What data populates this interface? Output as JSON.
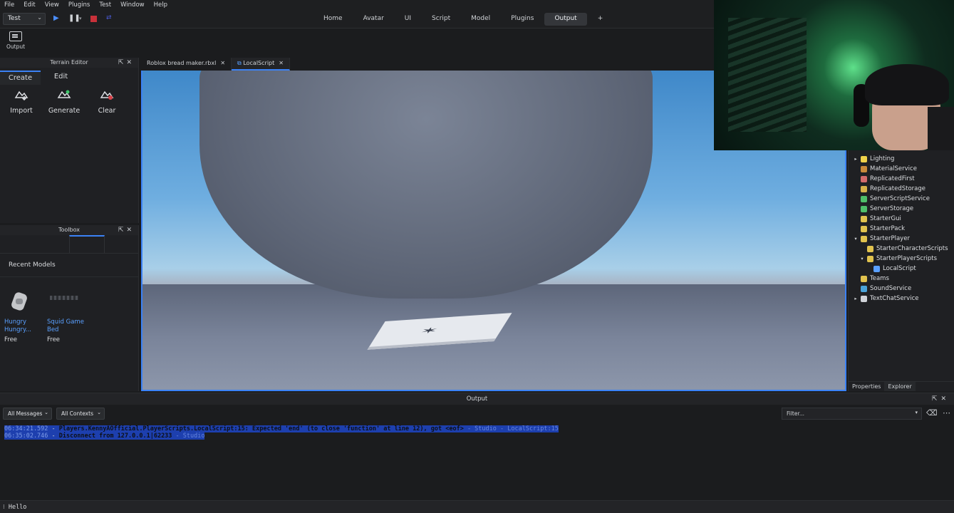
{
  "menubar": {
    "items": [
      "File",
      "Edit",
      "View",
      "Plugins",
      "Test",
      "Window",
      "Help"
    ]
  },
  "ribbon": {
    "mode": "Test",
    "tabs": [
      "Home",
      "Avatar",
      "UI",
      "Script",
      "Model",
      "Plugins",
      "Output",
      "+"
    ],
    "active_tab": "Output"
  },
  "toolbar": {
    "output_label": "Output"
  },
  "terrain_editor": {
    "title": "Terrain Editor",
    "tabs": [
      "Create",
      "Edit"
    ],
    "tools": [
      "Import",
      "Generate",
      "Clear"
    ]
  },
  "toolbox": {
    "title": "Toolbox",
    "section": "Recent Models",
    "items": [
      {
        "name": "Hungry Hungry...",
        "price": "Free"
      },
      {
        "name": "Squid Game Bed",
        "price": "Free"
      }
    ]
  },
  "doc_tabs": [
    {
      "label": "Roblox bread maker.rbxl"
    },
    {
      "label": "LocalScript"
    }
  ],
  "explorer": {
    "items": [
      {
        "label": "Lighting",
        "indent": 0,
        "arrow": "▸",
        "color": "#f0d24a"
      },
      {
        "label": "MaterialService",
        "indent": 0,
        "arrow": "",
        "color": "#c98a3b"
      },
      {
        "label": "ReplicatedFirst",
        "indent": 0,
        "arrow": "",
        "color": "#d36b6b"
      },
      {
        "label": "ReplicatedStorage",
        "indent": 0,
        "arrow": "",
        "color": "#d8b24a"
      },
      {
        "label": "ServerScriptService",
        "indent": 0,
        "arrow": "",
        "color": "#4fbf6a"
      },
      {
        "label": "ServerStorage",
        "indent": 0,
        "arrow": "",
        "color": "#4fbf6a"
      },
      {
        "label": "StarterGui",
        "indent": 0,
        "arrow": "",
        "color": "#e0c24e"
      },
      {
        "label": "StarterPack",
        "indent": 0,
        "arrow": "",
        "color": "#e0c24e"
      },
      {
        "label": "StarterPlayer",
        "indent": 0,
        "arrow": "▾",
        "color": "#e0c24e"
      },
      {
        "label": "StarterCharacterScripts",
        "indent": 1,
        "arrow": "",
        "color": "#e0c24e"
      },
      {
        "label": "StarterPlayerScripts",
        "indent": 1,
        "arrow": "▾",
        "color": "#e0c24e"
      },
      {
        "label": "LocalScript",
        "indent": 2,
        "arrow": "",
        "color": "#5aa0ff"
      },
      {
        "label": "Teams",
        "indent": 0,
        "arrow": "",
        "color": "#e0c24e"
      },
      {
        "label": "SoundService",
        "indent": 0,
        "arrow": "",
        "color": "#4aa3d9"
      },
      {
        "label": "TextChatService",
        "indent": 0,
        "arrow": "▸",
        "color": "#d0d3d8"
      }
    ],
    "bottom_tabs": [
      "Properties",
      "Explorer"
    ]
  },
  "output": {
    "title": "Output",
    "messages_filter": "All Messages",
    "contexts_filter": "All Contexts",
    "filter_placeholder": "Filter...",
    "lines": [
      {
        "time": "06:34:21.592",
        "text": "Players.KennyAOfficial.PlayerScripts.LocalScript:15: Expected 'end' (to close 'function' at line 12), got <eof>",
        "source": " - Studio - LocalScript:15"
      },
      {
        "time": "06:35:02.746",
        "text": "Disconnect from 127.0.0.1|62233",
        "source": " - Studio"
      }
    ],
    "command": "Hello"
  }
}
